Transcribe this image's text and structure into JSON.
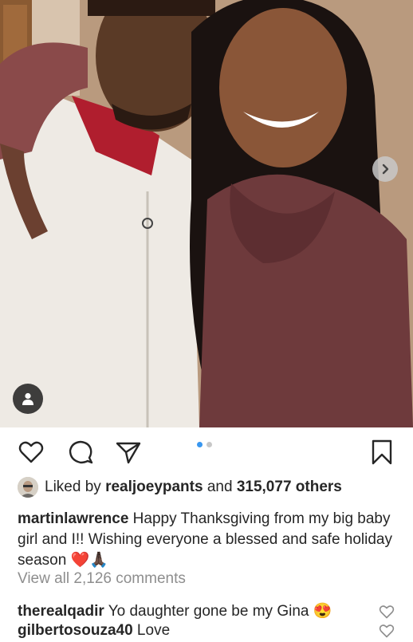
{
  "post": {
    "image_description_icons": {
      "next": "chevron-right-icon",
      "tag": "user-tag-icon"
    },
    "carousel": {
      "count": 2,
      "active": 0
    }
  },
  "actions": {
    "like": "heart-outline-icon",
    "comment": "comment-bubble-icon",
    "share": "paper-plane-icon",
    "save": "bookmark-icon"
  },
  "likes": {
    "prefix": "Liked by ",
    "user": "realjoeypants",
    "middle": " and ",
    "count": "315,077 others"
  },
  "caption": {
    "username": "martinlawrence",
    "text": " Happy Thanksgiving from my big baby girl and I!! Wishing everyone a blessed and safe holiday season ",
    "emoji": "❤️🙏🏿"
  },
  "view_all": "View all 2,126 comments",
  "comments": [
    {
      "username": "therealqadir",
      "text": " Yo daughter gone be my Gina 😍"
    },
    {
      "username": "gilbertosouza40",
      "text": " Love"
    }
  ],
  "colors": {
    "accent": "#3897f0",
    "muted": "#8e8e8e",
    "text": "#262626",
    "heart": "#ed4956"
  }
}
